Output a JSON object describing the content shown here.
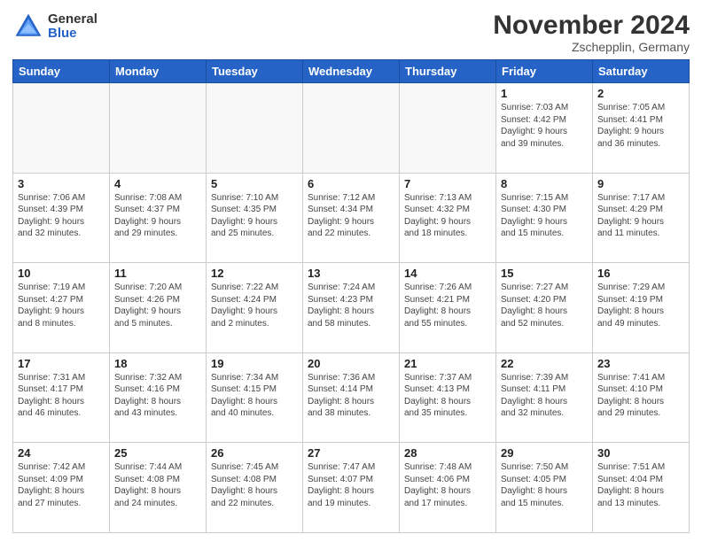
{
  "logo": {
    "general": "General",
    "blue": "Blue"
  },
  "title": "November 2024",
  "location": "Zschepplin, Germany",
  "days_header": [
    "Sunday",
    "Monday",
    "Tuesday",
    "Wednesday",
    "Thursday",
    "Friday",
    "Saturday"
  ],
  "weeks": [
    [
      {
        "day": "",
        "info": ""
      },
      {
        "day": "",
        "info": ""
      },
      {
        "day": "",
        "info": ""
      },
      {
        "day": "",
        "info": ""
      },
      {
        "day": "",
        "info": ""
      },
      {
        "day": "1",
        "info": "Sunrise: 7:03 AM\nSunset: 4:42 PM\nDaylight: 9 hours\nand 39 minutes."
      },
      {
        "day": "2",
        "info": "Sunrise: 7:05 AM\nSunset: 4:41 PM\nDaylight: 9 hours\nand 36 minutes."
      }
    ],
    [
      {
        "day": "3",
        "info": "Sunrise: 7:06 AM\nSunset: 4:39 PM\nDaylight: 9 hours\nand 32 minutes."
      },
      {
        "day": "4",
        "info": "Sunrise: 7:08 AM\nSunset: 4:37 PM\nDaylight: 9 hours\nand 29 minutes."
      },
      {
        "day": "5",
        "info": "Sunrise: 7:10 AM\nSunset: 4:35 PM\nDaylight: 9 hours\nand 25 minutes."
      },
      {
        "day": "6",
        "info": "Sunrise: 7:12 AM\nSunset: 4:34 PM\nDaylight: 9 hours\nand 22 minutes."
      },
      {
        "day": "7",
        "info": "Sunrise: 7:13 AM\nSunset: 4:32 PM\nDaylight: 9 hours\nand 18 minutes."
      },
      {
        "day": "8",
        "info": "Sunrise: 7:15 AM\nSunset: 4:30 PM\nDaylight: 9 hours\nand 15 minutes."
      },
      {
        "day": "9",
        "info": "Sunrise: 7:17 AM\nSunset: 4:29 PM\nDaylight: 9 hours\nand 11 minutes."
      }
    ],
    [
      {
        "day": "10",
        "info": "Sunrise: 7:19 AM\nSunset: 4:27 PM\nDaylight: 9 hours\nand 8 minutes."
      },
      {
        "day": "11",
        "info": "Sunrise: 7:20 AM\nSunset: 4:26 PM\nDaylight: 9 hours\nand 5 minutes."
      },
      {
        "day": "12",
        "info": "Sunrise: 7:22 AM\nSunset: 4:24 PM\nDaylight: 9 hours\nand 2 minutes."
      },
      {
        "day": "13",
        "info": "Sunrise: 7:24 AM\nSunset: 4:23 PM\nDaylight: 8 hours\nand 58 minutes."
      },
      {
        "day": "14",
        "info": "Sunrise: 7:26 AM\nSunset: 4:21 PM\nDaylight: 8 hours\nand 55 minutes."
      },
      {
        "day": "15",
        "info": "Sunrise: 7:27 AM\nSunset: 4:20 PM\nDaylight: 8 hours\nand 52 minutes."
      },
      {
        "day": "16",
        "info": "Sunrise: 7:29 AM\nSunset: 4:19 PM\nDaylight: 8 hours\nand 49 minutes."
      }
    ],
    [
      {
        "day": "17",
        "info": "Sunrise: 7:31 AM\nSunset: 4:17 PM\nDaylight: 8 hours\nand 46 minutes."
      },
      {
        "day": "18",
        "info": "Sunrise: 7:32 AM\nSunset: 4:16 PM\nDaylight: 8 hours\nand 43 minutes."
      },
      {
        "day": "19",
        "info": "Sunrise: 7:34 AM\nSunset: 4:15 PM\nDaylight: 8 hours\nand 40 minutes."
      },
      {
        "day": "20",
        "info": "Sunrise: 7:36 AM\nSunset: 4:14 PM\nDaylight: 8 hours\nand 38 minutes."
      },
      {
        "day": "21",
        "info": "Sunrise: 7:37 AM\nSunset: 4:13 PM\nDaylight: 8 hours\nand 35 minutes."
      },
      {
        "day": "22",
        "info": "Sunrise: 7:39 AM\nSunset: 4:11 PM\nDaylight: 8 hours\nand 32 minutes."
      },
      {
        "day": "23",
        "info": "Sunrise: 7:41 AM\nSunset: 4:10 PM\nDaylight: 8 hours\nand 29 minutes."
      }
    ],
    [
      {
        "day": "24",
        "info": "Sunrise: 7:42 AM\nSunset: 4:09 PM\nDaylight: 8 hours\nand 27 minutes."
      },
      {
        "day": "25",
        "info": "Sunrise: 7:44 AM\nSunset: 4:08 PM\nDaylight: 8 hours\nand 24 minutes."
      },
      {
        "day": "26",
        "info": "Sunrise: 7:45 AM\nSunset: 4:08 PM\nDaylight: 8 hours\nand 22 minutes."
      },
      {
        "day": "27",
        "info": "Sunrise: 7:47 AM\nSunset: 4:07 PM\nDaylight: 8 hours\nand 19 minutes."
      },
      {
        "day": "28",
        "info": "Sunrise: 7:48 AM\nSunset: 4:06 PM\nDaylight: 8 hours\nand 17 minutes."
      },
      {
        "day": "29",
        "info": "Sunrise: 7:50 AM\nSunset: 4:05 PM\nDaylight: 8 hours\nand 15 minutes."
      },
      {
        "day": "30",
        "info": "Sunrise: 7:51 AM\nSunset: 4:04 PM\nDaylight: 8 hours\nand 13 minutes."
      }
    ]
  ]
}
